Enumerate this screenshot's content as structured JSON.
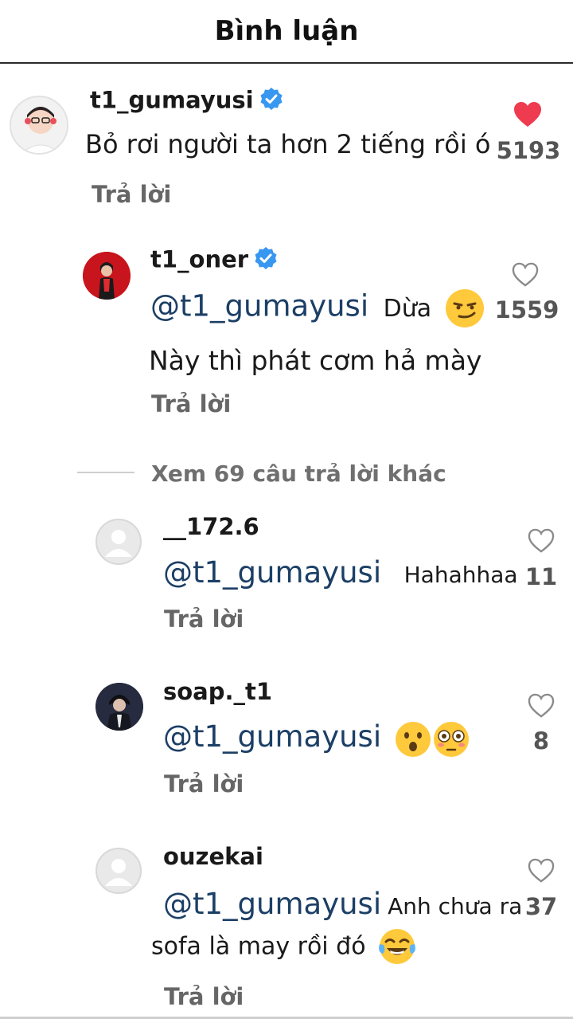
{
  "header": {
    "title": "Bình luận"
  },
  "main_comment": {
    "username": "t1_gumayusi",
    "text": "Bỏ rơi người ta hơn 2 tiếng rồi ó",
    "likes": "5193",
    "liked": true,
    "reply_label": "Trả lời"
  },
  "pinned_reply": {
    "username": "t1_oner",
    "mention": "@t1_gumayusi",
    "text_line1": "Dừa",
    "text_line2": "Này thì phát cơm hả mày",
    "likes": "1559",
    "reply_label": "Trả lời"
  },
  "view_more": {
    "label": "Xem 69 câu trả lời khác"
  },
  "replies": [
    {
      "username": "__172.6",
      "mention": "@t1_gumayusi",
      "text": "Hahahhaa",
      "likes": "11",
      "reply_label": "Trả lời"
    },
    {
      "username": "soap._t1",
      "mention": "@t1_gumayusi",
      "text": "",
      "likes": "8",
      "reply_label": "Trả lời"
    },
    {
      "username": "ouzekai",
      "mention": "@t1_gumayusi",
      "text_line1": "Anh chưa ra",
      "text_line2": "sofa là may rồi đó",
      "likes": "37",
      "reply_label": "Trả lời"
    }
  ],
  "colors": {
    "heart_liked": "#ee3b4f",
    "verified_badge": "#3897f0",
    "mention": "#1c3f66"
  }
}
